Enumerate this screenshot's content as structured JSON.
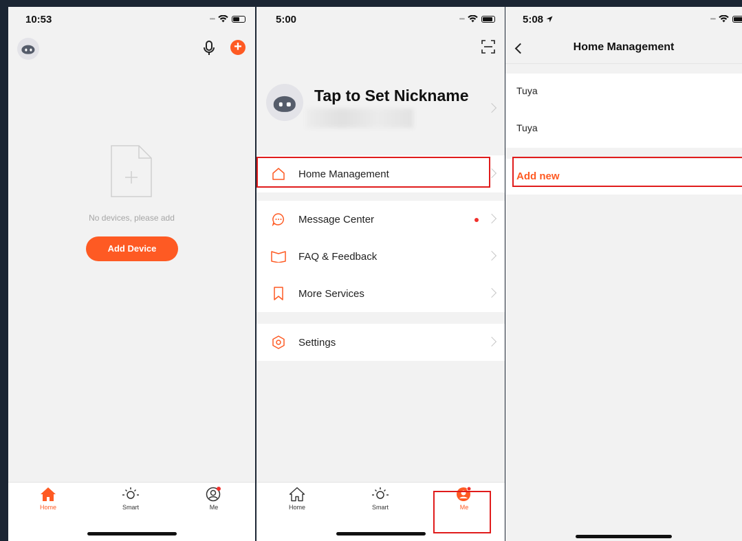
{
  "colors": {
    "accent": "#fe5a23",
    "highlight": "#e01b1b",
    "background": "#f2f2f2"
  },
  "screen1": {
    "time": "10:53",
    "empty_text": "No devices, please add",
    "add_device_label": "Add Device",
    "tabs": [
      {
        "label": "Home",
        "icon": "home-icon"
      },
      {
        "label": "Smart",
        "icon": "sun-icon"
      },
      {
        "label": "Me",
        "icon": "user-icon"
      }
    ]
  },
  "screen2": {
    "time": "5:00",
    "nickname": "Tap to Set Nickname",
    "menu": [
      {
        "label": "Home Management",
        "icon": "house-icon"
      },
      {
        "label": "Message Center",
        "icon": "message-icon"
      },
      {
        "label": "FAQ & Feedback",
        "icon": "book-icon"
      },
      {
        "label": "More Services",
        "icon": "bookmark-icon"
      },
      {
        "label": "Settings",
        "icon": "settings-icon"
      }
    ],
    "tabs": [
      {
        "label": "Home",
        "icon": "home-icon"
      },
      {
        "label": "Smart",
        "icon": "sun-icon"
      },
      {
        "label": "Me",
        "icon": "user-icon"
      }
    ]
  },
  "screen3": {
    "time": "5:08",
    "title": "Home Management",
    "homes": [
      "Tuya",
      "Tuya"
    ],
    "add_new_label": "Add new"
  }
}
